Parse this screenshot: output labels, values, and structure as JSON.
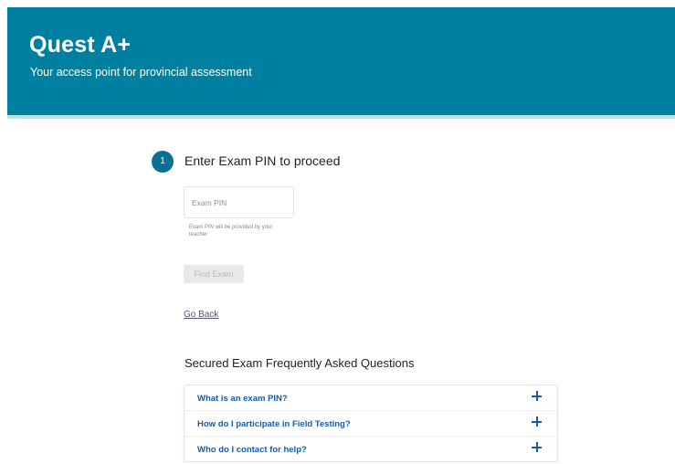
{
  "header": {
    "title": "Quest A+",
    "subtitle": "Your access point for provincial assessment",
    "background_color": "#0080a0"
  },
  "step": {
    "number": "1",
    "title": "Enter Exam PIN to proceed"
  },
  "pin": {
    "placeholder": "Exam PIN",
    "value": "",
    "help_text": "Exam PIN will be provided by your teacher"
  },
  "actions": {
    "find_exam_label": "Find Exam",
    "find_exam_disabled": true,
    "go_back_label": "Go Back"
  },
  "faq": {
    "title": "Secured Exam Frequently Asked Questions",
    "items": [
      {
        "question": "What is an exam PIN?",
        "icon": "plus-icon"
      },
      {
        "question": "How do I participate in Field Testing?",
        "icon": "plus-icon"
      },
      {
        "question": "Who do I contact for help?",
        "icon": "plus-icon"
      }
    ]
  }
}
